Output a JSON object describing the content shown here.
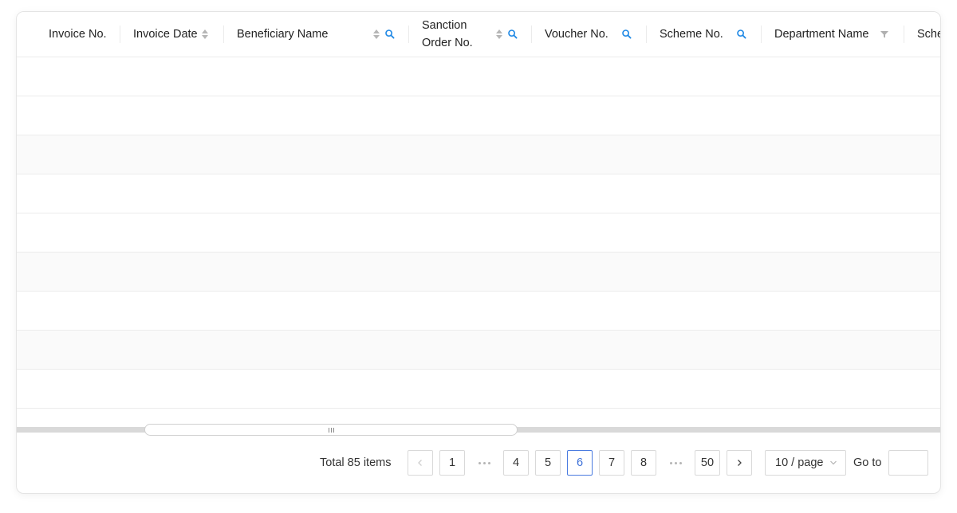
{
  "table": {
    "columns": [
      {
        "label": "Invoice No.",
        "sortable": false,
        "searchable": false,
        "filterable": false
      },
      {
        "label": "Invoice Date",
        "sortable": true,
        "searchable": false,
        "filterable": false
      },
      {
        "label": "Beneficiary Name",
        "sortable": true,
        "searchable": true,
        "filterable": false
      },
      {
        "label": "Sanction\nOrder No.",
        "sortable": true,
        "searchable": true,
        "filterable": false
      },
      {
        "label": "Voucher No.",
        "sortable": false,
        "searchable": true,
        "filterable": false
      },
      {
        "label": "Scheme No.",
        "sortable": false,
        "searchable": true,
        "filterable": false
      },
      {
        "label": "Department Name",
        "sortable": false,
        "searchable": false,
        "filterable": true
      },
      {
        "label": "Sche",
        "sortable": false,
        "searchable": false,
        "filterable": false
      }
    ],
    "rows": [
      [],
      [],
      [],
      [],
      [],
      [],
      [],
      [],
      []
    ]
  },
  "pagination": {
    "total_text": "Total 85 items",
    "pages": [
      "1",
      "4",
      "5",
      "6",
      "7",
      "8",
      "50"
    ],
    "current_page": "6",
    "page_size": "10 / page",
    "goto_label": "Go to",
    "goto_value": ""
  },
  "colors": {
    "accent": "#3b6fd8",
    "search_icon": "#1e88e5",
    "border": "#d9d9d9",
    "row_alt": "#fafafa"
  },
  "icons": {
    "sort": "sort-icon",
    "search": "search-icon",
    "filter": "filter-icon",
    "prev": "chevron-left-icon",
    "next": "chevron-right-icon",
    "dropdown": "chevron-down-icon"
  }
}
